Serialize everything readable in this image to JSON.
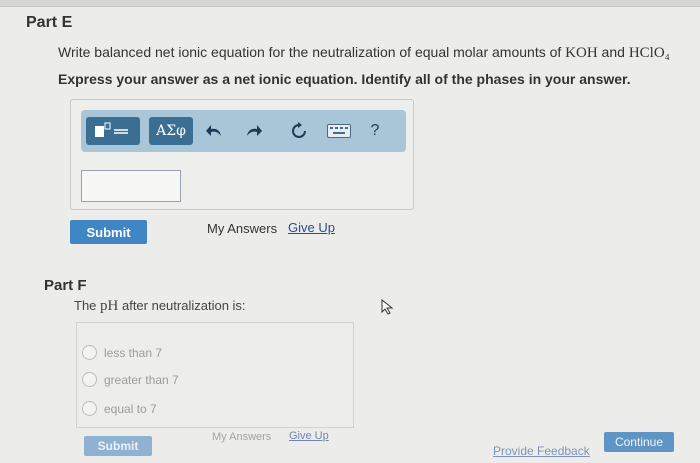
{
  "part_e": {
    "title": "Part E",
    "question_prefix": "Write balanced net ionic equation for the neutralization of equal molar amounts of ",
    "chem1": "KOH",
    "and_text": " and ",
    "chem2": "HClO₄",
    "instruction": "Express your answer as a net ionic equation. Identify all of the phases in your answer.",
    "toolbar": {
      "greek_label": "ΑΣφ",
      "help_label": "?"
    },
    "answer_value": "",
    "submit_label": "Submit",
    "my_answers_label": "My Answers",
    "give_up_label": "Give Up"
  },
  "part_f": {
    "title": "Part F",
    "question_prefix": "The ",
    "chem": "pH",
    "question_suffix": " after neutralization is:",
    "options": [
      "less than 7",
      "greater than 7",
      "equal to 7"
    ],
    "submit_label": "Submit",
    "my_answers_label": "My Answers",
    "give_up_label": "Give Up"
  },
  "footer": {
    "feedback_label": "Provide Feedback",
    "continue_label": "Continue"
  },
  "colors": {
    "toolbar_bg": "#a9c6d8",
    "button_dark": "#3a6f93",
    "submit_blue": "#3f86c4",
    "continue_blue": "#5f95c4"
  }
}
